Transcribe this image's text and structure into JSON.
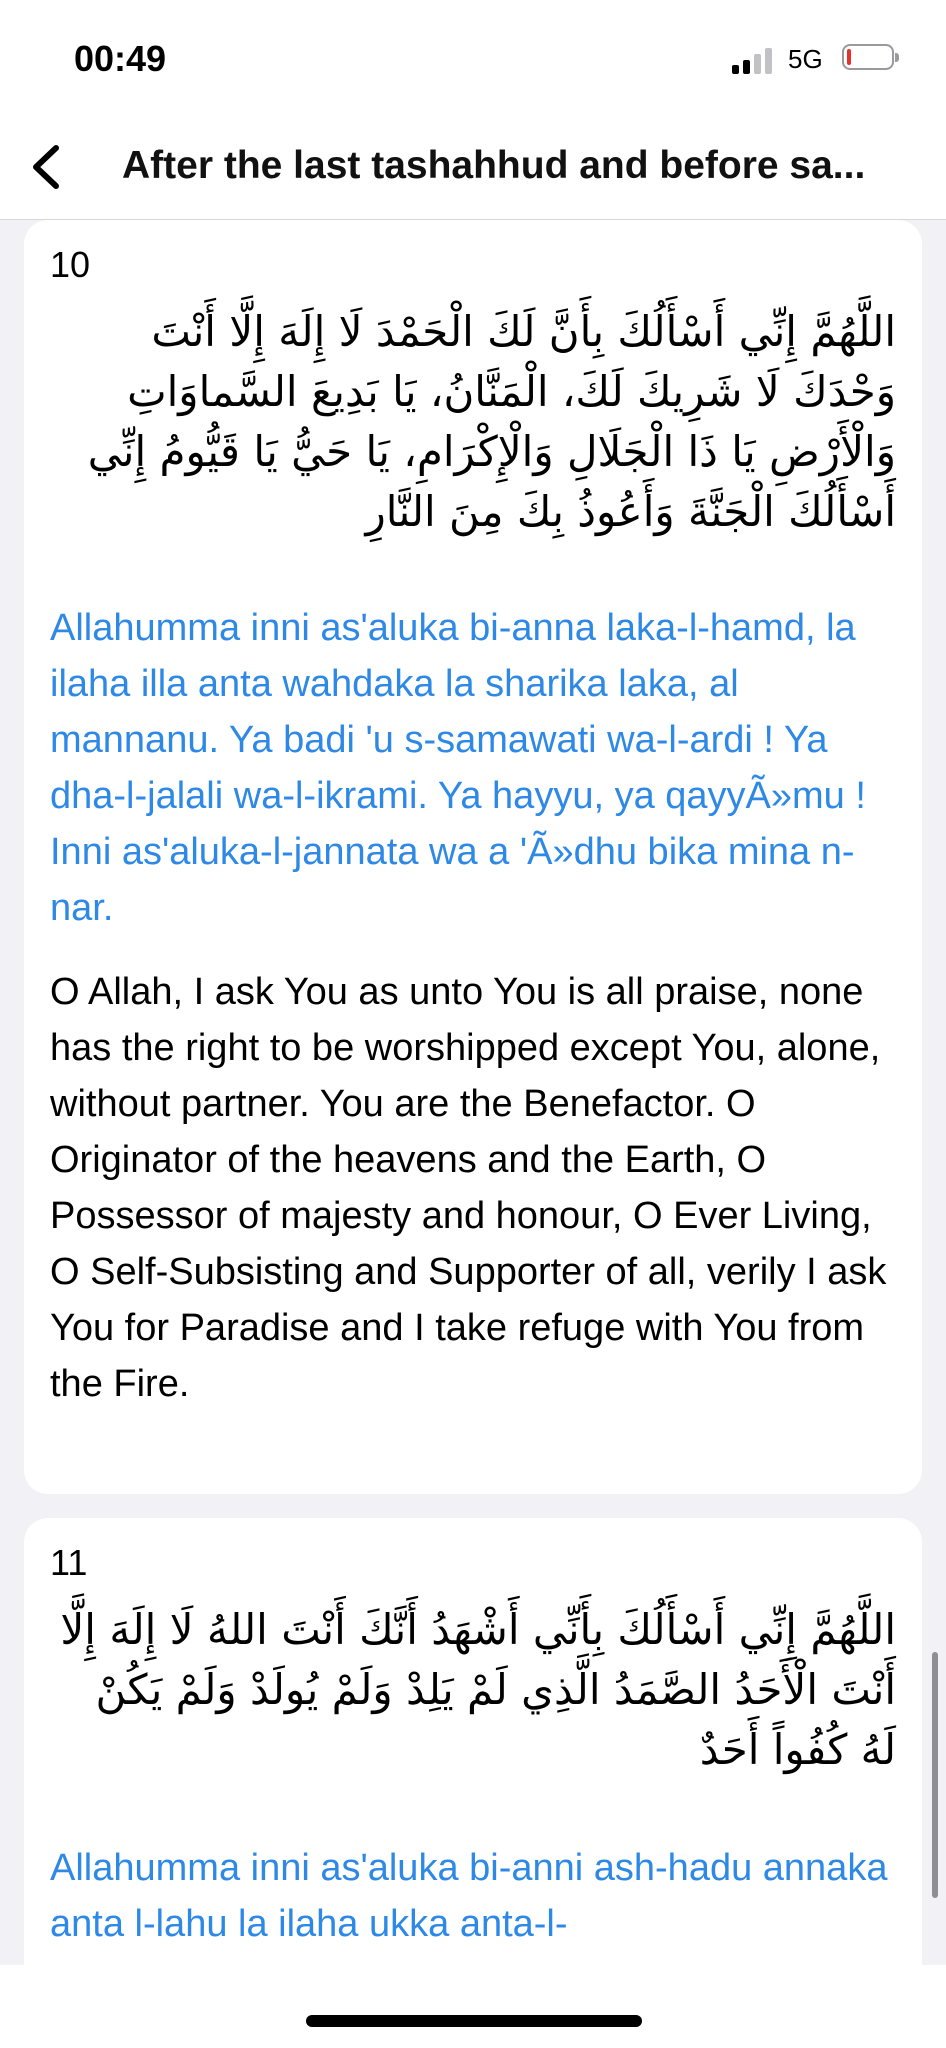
{
  "status_bar": {
    "time": "00:49",
    "network": "5G",
    "battery_color": "#e5332a"
  },
  "nav": {
    "back_icon": "chevron-left-icon",
    "title": "After the last tashahhud and before sa..."
  },
  "cards": [
    {
      "number": "10",
      "arabic": "اللَّهُمَّ إِنِّي أَسْأَلُكَ بِأَنَّ لَكَ الْحَمْدَ لَا إِلَهَ إِلَّا أَنْتَ وَحْدَكَ لَا شَرِيكَ لَكَ، الْمَنَّانُ، يَا بَدِيعَ السَّماوَاتِ وَالْأَرْضِ يَا ذَا الْجَلَالِ وَالْإِكْرَامِ، يَا حَيُّ يَا قَيُّومُ إِنِّي أَسْأَلُكَ الْجَنَّةَ وَأَعُوذُ بِكَ مِنَ النَّارِ",
      "transliteration": "Allahumma inni as'aluka bi-anna laka-l-hamd, la ilaha illa anta wahdaka la sharika laka, al mannanu. Ya badi 'u s-samawati wa-l-ardi ! Ya dha-l-jalali wa-l-ikrami. Ya hayyu, ya qayyÃ»mu ! Inni as'aluka-l-jannata wa a 'Ã»dhu bika mina n-nar.",
      "translation": "O Allah, I ask You as unto You is all praise, none has the right to be worshipped except You, alone, without partner. You are the Benefactor. O Originator of the heavens and the Earth, O Possessor of majesty and honour, O Ever Living, O Self-Subsisting and Supporter of all, verily I ask You for Paradise and I take refuge with You from the Fire."
    },
    {
      "number": "11",
      "arabic": "اللَّهُمَّ إِنِّي أَسْأَلُكَ بِأَنِّي أَشْهَدُ أَنَّكَ أَنْتَ اللهُ لَا إِلَهَ إِلَّا أَنْتَ الْأَحَدُ الصَّمَدُ الَّذِي لَمْ يَلِدْ وَلَمْ يُولَدْ وَلَمْ يَكُنْ لَهُ كُفُواً أَحَدٌ",
      "transliteration": "Allahumma inni as'aluka bi-anni ash-hadu annaka anta l-lahu la ilaha ukka anta-l-"
    }
  ]
}
